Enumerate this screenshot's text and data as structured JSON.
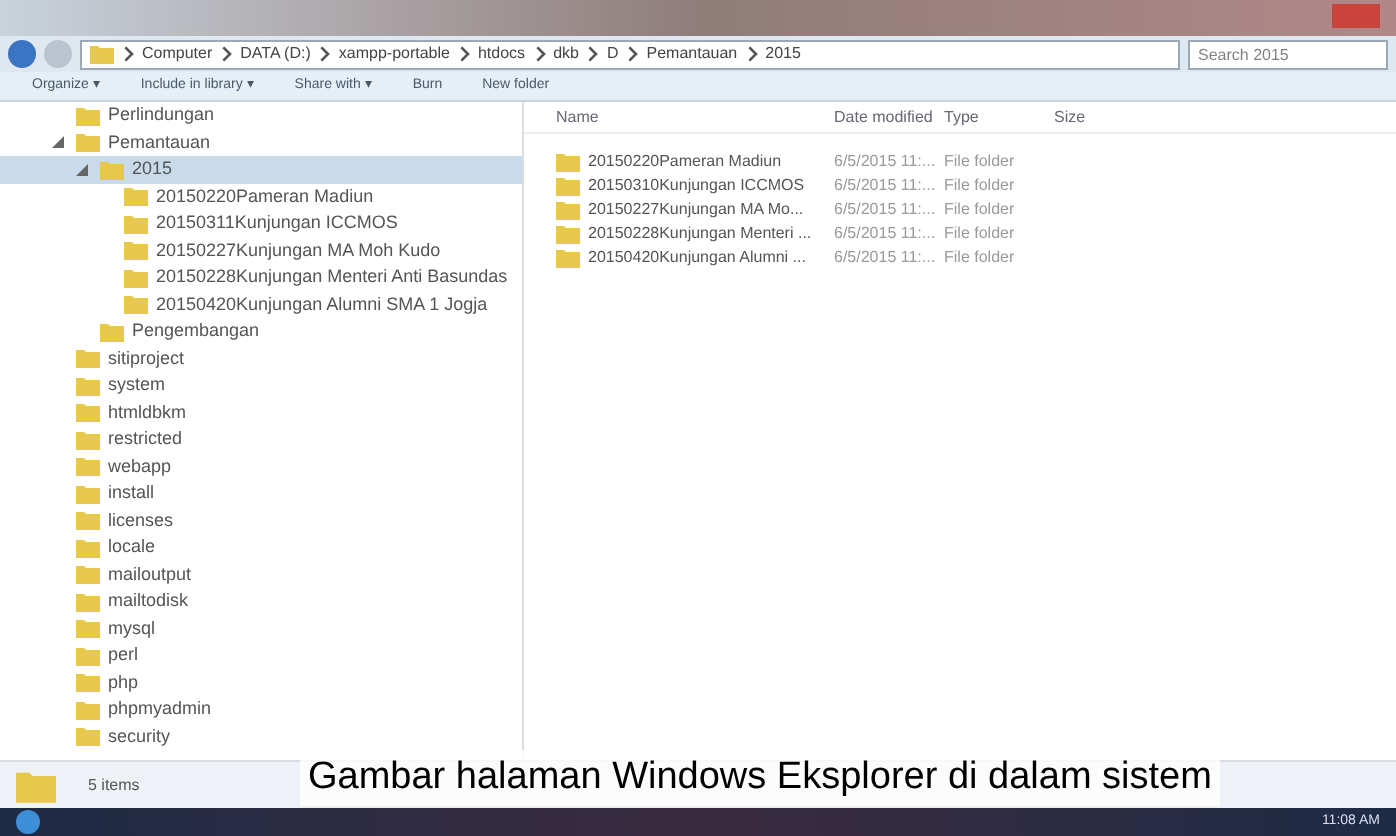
{
  "window": {
    "breadcrumb": [
      "Computer",
      "DATA (D:)",
      "xampp-portable",
      "htdocs",
      "dkb",
      "D",
      "Pemantauan",
      "2015"
    ],
    "search": {
      "placeholder": "Search 2015"
    }
  },
  "toolbar": [
    "Organize ▾",
    "Include in library ▾",
    "Share with ▾",
    "Burn",
    "New folder"
  ],
  "tree": [
    {
      "label": "Perlindungan",
      "expanded": false,
      "selected": false
    },
    {
      "label": "Pemantauan",
      "expanded": true,
      "selected": false,
      "children": [
        {
          "label": "2015",
          "expanded": true,
          "selected": true,
          "children": [
            {
              "label": "20150220Pameran Madiun",
              "expanded": false,
              "selected": false
            },
            {
              "label": "20150311Kunjungan ICCMOS",
              "expanded": false,
              "selected": false
            },
            {
              "label": "20150227Kunjungan MA Moh Kudo",
              "expanded": false,
              "selected": false
            },
            {
              "label": "20150228Kunjungan Menteri Anti Basundas",
              "expanded": false,
              "selected": false
            },
            {
              "label": "20150420Kunjungan Alumni SMA 1 Jogja",
              "expanded": false,
              "selected": false
            }
          ]
        },
        {
          "label": "Pengembangan",
          "expanded": false,
          "selected": false
        }
      ]
    },
    {
      "label": "sitiproject",
      "expanded": false,
      "selected": false
    },
    {
      "label": "system",
      "expanded": false,
      "selected": false
    },
    {
      "label": "htmldbkm",
      "expanded": false,
      "selected": false
    },
    {
      "label": "restricted",
      "expanded": false,
      "selected": false
    },
    {
      "label": "webapp",
      "expanded": false,
      "selected": false
    },
    {
      "label": "install",
      "expanded": false,
      "selected": false
    },
    {
      "label": "licenses",
      "expanded": false,
      "selected": false
    },
    {
      "label": "locale",
      "expanded": false,
      "selected": false
    },
    {
      "label": "mailoutput",
      "expanded": false,
      "selected": false
    },
    {
      "label": "mailtodisk",
      "expanded": false,
      "selected": false
    },
    {
      "label": "mysql",
      "expanded": false,
      "selected": false
    },
    {
      "label": "perl",
      "expanded": false,
      "selected": false
    },
    {
      "label": "php",
      "expanded": false,
      "selected": false
    },
    {
      "label": "phpmyadmin",
      "expanded": false,
      "selected": false
    },
    {
      "label": "security",
      "expanded": false,
      "selected": false
    }
  ],
  "table": {
    "columns": [
      "Name",
      "Date modified",
      "Type",
      "Size"
    ],
    "rows": [
      [
        "20150220Pameran Madiun",
        "6/5/2015 11:...",
        "File folder"
      ],
      [
        "20150310Kunjungan ICCMOS",
        "6/5/2015 11:...",
        "File folder"
      ],
      [
        "20150227Kunjungan MA Mo...",
        "6/5/2015 11:...",
        "File folder"
      ],
      [
        "20150228Kunjungan Menteri ...",
        "6/5/2015 11:...",
        "File folder"
      ],
      [
        "20150420Kunjungan Alumni ...",
        "6/5/2015 11:...",
        "File folder"
      ]
    ]
  },
  "status_bar": "5 items",
  "caption": "Gambar halaman Windows Eksplorer di dalam sistem",
  "taskbar": {
    "clock": "11:08 AM"
  }
}
